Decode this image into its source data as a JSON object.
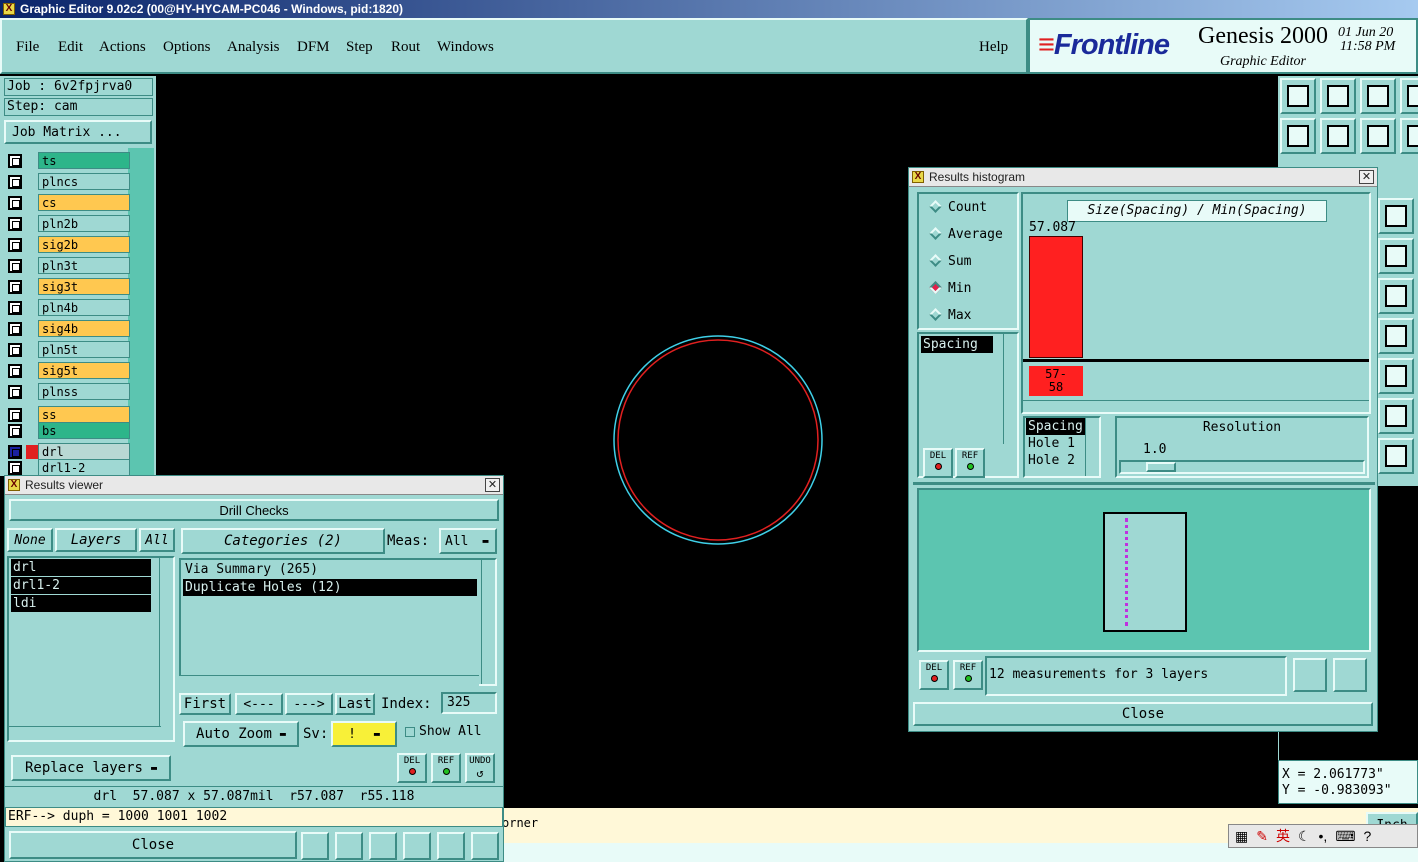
{
  "window": {
    "title": "Graphic Editor 9.02c2 (00@HY-HYCAM-PC046 - Windows, pid:1820)"
  },
  "menu": {
    "items": [
      "File",
      "Edit",
      "Actions",
      "Options",
      "Analysis",
      "DFM",
      "Step",
      "Rout",
      "Windows"
    ],
    "help": "Help"
  },
  "brand": {
    "logo": "Frontline",
    "product": "Genesis 2000",
    "subtitle": "Graphic Editor",
    "date": "01 Jun 20",
    "time": "11:58 PM"
  },
  "left_panel": {
    "job": "Job : 6v2fpjrva0",
    "step": "Step: cam",
    "job_matrix": "Job Matrix ...",
    "layers": [
      {
        "name": "ts",
        "color": "#2db58a"
      },
      {
        "name": "plncs",
        "color": "#9fd8d3"
      },
      {
        "name": "cs",
        "color": "#ffc850"
      },
      {
        "name": "pln2b",
        "color": "#9fd8d3"
      },
      {
        "name": "sig2b",
        "color": "#ffc850"
      },
      {
        "name": "pln3t",
        "color": "#9fd8d3"
      },
      {
        "name": "sig3t",
        "color": "#ffc850"
      },
      {
        "name": "pln4b",
        "color": "#9fd8d3"
      },
      {
        "name": "sig4b",
        "color": "#ffc850"
      },
      {
        "name": "pln5t",
        "color": "#9fd8d3"
      },
      {
        "name": "sig5t",
        "color": "#ffc850"
      },
      {
        "name": "plnss",
        "color": "#9fd8d3"
      },
      {
        "name": "ss",
        "color": "#ffc850"
      },
      {
        "name": "bs",
        "color": "#2db58a"
      },
      {
        "name": "drl",
        "color": "#b8d8d4"
      },
      {
        "name": "drl1-2",
        "color": "#9fd8d3"
      }
    ]
  },
  "results_viewer": {
    "title": "Results viewer",
    "header": "Drill Checks",
    "none_btn": "None",
    "layers_btn": "Layers",
    "all_btn": "All",
    "layer_list": [
      "drl",
      "drl1-2",
      "ldi"
    ],
    "categories_btn": "Categories (2)",
    "meas_label": "Meas:",
    "meas_value": "All",
    "categories": [
      "Via Summary (265)",
      "Duplicate Holes (12)"
    ],
    "first": "First",
    "prev": "<---",
    "next": "--->",
    "last": "Last",
    "index_label": "Index:",
    "index_value": "325",
    "auto_zoom": "Auto Zoom",
    "sv_label": "Sv:",
    "sv_value": "!",
    "show_all": "Show All",
    "replace_layers": "Replace layers",
    "del": "DEL",
    "ref": "REF",
    "undo": "UNDO",
    "info_line": "drl  57.087 x 57.087mil  r57.087  r55.118",
    "erf_line": "ERF--> duph = 1000 1001 1002",
    "close": "Close"
  },
  "histogram": {
    "title": "Results histogram",
    "modes": [
      "Count",
      "Average",
      "Sum",
      "Min",
      "Max"
    ],
    "selected_mode": "Min",
    "list_top": [
      "Spacing"
    ],
    "chart_title": "Size(Spacing) / Min(Spacing)",
    "bar_value": "57.087",
    "bar_label_line1": "57-",
    "bar_label_line2": "58",
    "bar_color": "#ff2020",
    "list_bottom": [
      "Spacing",
      "Hole 1",
      "Hole 2"
    ],
    "resolution_label": "Resolution",
    "resolution_value": "1.0",
    "resolution_level": 0.12,
    "measurements": "12 measurements for 3 layers",
    "del": "DEL",
    "ref": "REF",
    "close": "Close"
  },
  "status": {
    "corner_text": "orner",
    "x": "X = 2.061773\"",
    "y": "Y = -0.983093\"",
    "inch": "Inch",
    "ime": "英"
  }
}
